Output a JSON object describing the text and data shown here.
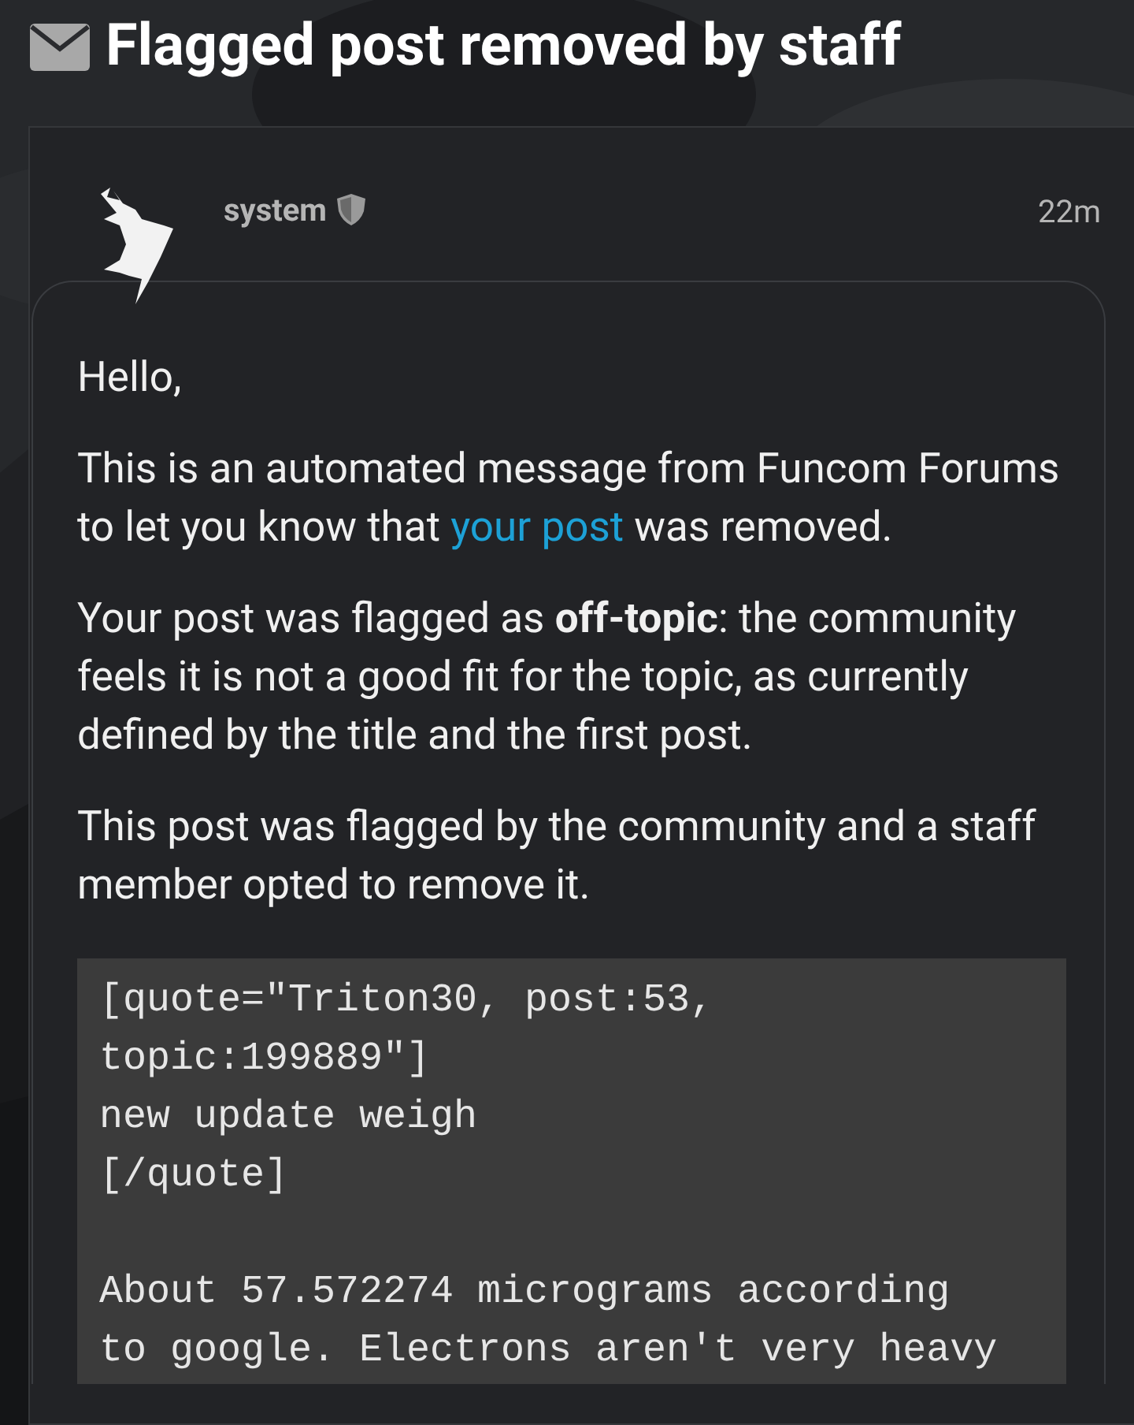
{
  "title": "Flagged post removed by staff",
  "post": {
    "username": "system",
    "staff": true,
    "time": "22m",
    "paragraphs": [
      [
        {
          "kind": "plain",
          "text": "Hello,"
        }
      ],
      [
        {
          "kind": "plain",
          "text": "This is an automated message from Funcom Forums to let you know that "
        },
        {
          "kind": "link",
          "text": "your post"
        },
        {
          "kind": "plain",
          "text": " was removed."
        }
      ],
      [
        {
          "kind": "plain",
          "text": "Your post was flagged as **off-topic**: the community feels it is not a good fit for the topic, as currently defined by the title and the first post."
        }
      ],
      [
        {
          "kind": "plain",
          "text": "This post was flagged by the community and a staff member opted to remove it."
        }
      ]
    ],
    "code": "[quote=\"Triton30, post:53,\ntopic:199889\"]\nnew update weigh\n[/quote]\n\nAbout 57.572274 micrograms according\nto google. Electrons aren't very heavy"
  }
}
